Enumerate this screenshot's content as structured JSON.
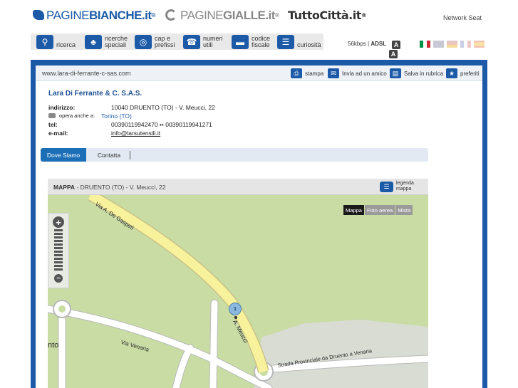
{
  "brands": {
    "paginebianche": {
      "prefix": "PAGINE",
      "suffix": "BIANCHE",
      "tld": ".it",
      "reg": "®"
    },
    "paginegialle": {
      "prefix": "PAGINE",
      "suffix": "GIALLE",
      "tld": ".it",
      "reg": "®"
    },
    "tuttocitta": {
      "name": "TuttoCittà",
      "tld": ".it",
      "reg": "®"
    },
    "network_seat": "Network Seat"
  },
  "toolbar": [
    {
      "label": "ricerca",
      "icon": "magnifier-icon"
    },
    {
      "label": "ricerche speciali",
      "icon": "clover-icon"
    },
    {
      "label": "cap e prefissi",
      "icon": "globe-icon"
    },
    {
      "label": "numeri utili",
      "icon": "phone-icon"
    },
    {
      "label": "codice fiscale",
      "icon": "card-icon"
    },
    {
      "label": "curiosità",
      "icon": "list-icon"
    }
  ],
  "connection": {
    "speed": "56kbps",
    "separator": "|",
    "type": "ADSL"
  },
  "text_size_badges": [
    "A",
    "A"
  ],
  "languages": [
    "it",
    "en",
    "de",
    "fr",
    "es"
  ],
  "url": "www.lara-di-ferrante-c-sas.com",
  "actions": [
    {
      "label": "stampa",
      "icon": "print-icon"
    },
    {
      "label": "Invia ad un amico",
      "icon": "mail-icon"
    },
    {
      "label": "Salva in rubrica",
      "icon": "folder-icon"
    },
    {
      "label": "preferiti",
      "icon": "star-icon"
    }
  ],
  "company": {
    "name": "Lara Di Ferrante & C. S.A.S.",
    "address_label": "indirizzo:",
    "address": "10040 DRUENTO (TO) - V. Meucci, 22",
    "also_label": "opera anche a:",
    "also_value": "Torino (TO)",
    "tel_label": "tel:",
    "tel": "00390119942470 •• 00390119941271",
    "email_label": "e-mail:",
    "email": "info@larsutensili.it"
  },
  "tabs": {
    "active": "Dove Siamo",
    "other": "Contatta"
  },
  "map": {
    "title_label": "MAPPA",
    "title_sep": " - ",
    "title_address": "DRUENTO (TO) - V. Meucci, 22",
    "legend": "legenda mappa",
    "types": [
      "Mappa",
      "Foto aerea",
      "Mista"
    ],
    "zoom_in": "+",
    "zoom_out": "−",
    "pin_number": "1",
    "road_labels": [
      "Via A. De Gaspeti",
      "A. Meucci",
      "Via Venaria",
      "Strada Provinciale da Druento a Venaria",
      "nto"
    ],
    "colors": {
      "land": "#c8dca4",
      "road_main": "#f8f29c",
      "road": "#ffffff",
      "road_edge": "#b9b9b9"
    }
  }
}
